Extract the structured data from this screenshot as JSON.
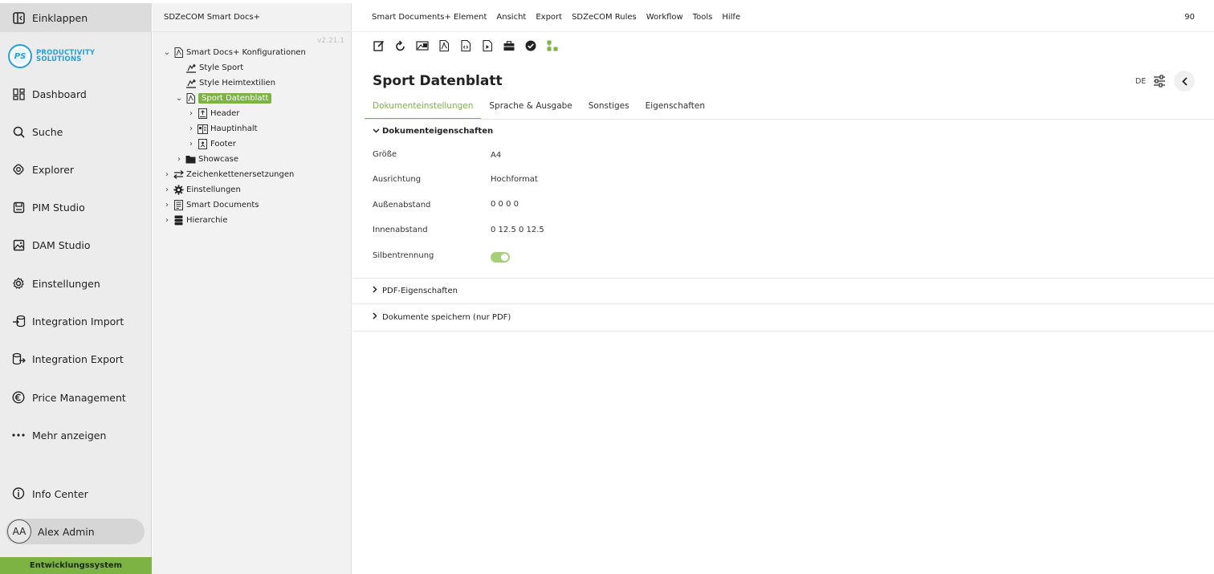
{
  "sidebar": {
    "collapse_label": "Einklappen",
    "logo_initials": "PS",
    "logo_line1": "PRODUCTIVITY",
    "logo_line2": "SOLUTIONS",
    "items": [
      {
        "label": "Dashboard",
        "icon": "dashboard-icon"
      },
      {
        "label": "Suche",
        "icon": "search-icon"
      },
      {
        "label": "Explorer",
        "icon": "explorer-icon"
      },
      {
        "label": "PIM Studio",
        "icon": "pim-icon"
      },
      {
        "label": "DAM Studio",
        "icon": "image-icon"
      },
      {
        "label": "Einstellungen",
        "icon": "gear-icon"
      },
      {
        "label": "Integration Import",
        "icon": "import-icon"
      },
      {
        "label": "Integration Export",
        "icon": "export-icon"
      },
      {
        "label": "Price Management",
        "icon": "euro-icon"
      },
      {
        "label": "Mehr anzeigen",
        "icon": "more-icon"
      }
    ],
    "info_center": "Info Center",
    "user_initials": "AA",
    "user_name": "Alex Admin",
    "environment": "Entwicklungssystem"
  },
  "tree": {
    "header": "SDZeCOM Smart Docs+",
    "version": "v2.21.1",
    "nodes": [
      {
        "label": "Smart Docs+ Konfigurationen"
      },
      {
        "label": "Style Sport"
      },
      {
        "label": "Style Heimtextilien"
      },
      {
        "label": "Sport Datenblatt"
      },
      {
        "label": "Header"
      },
      {
        "label": "Hauptinhalt"
      },
      {
        "label": "Footer"
      },
      {
        "label": "Showcase"
      },
      {
        "label": "Zeichenkettenersetzungen"
      },
      {
        "label": "Einstellungen"
      },
      {
        "label": "Smart Documents"
      },
      {
        "label": "Hierarchie"
      }
    ]
  },
  "menubar": {
    "items": [
      "Smart Documents+ Element",
      "Ansicht",
      "Export",
      "SDZeCOM Rules",
      "Workflow",
      "Tools",
      "Hilfe"
    ],
    "right_value": "90"
  },
  "document": {
    "title": "Sport Datenblatt",
    "language": "DE",
    "tabs": [
      "Dokumenteinstellungen",
      "Sprache & Ausgabe",
      "Sonstiges",
      "Eigenschaften"
    ],
    "section_main": "Dokumenteigenschaften",
    "properties": [
      {
        "label": "Größe",
        "value": "A4"
      },
      {
        "label": "Ausrichtung",
        "value": "Hochformat"
      },
      {
        "label": "Außenabstand",
        "value": "0 0 0 0"
      },
      {
        "label": "Innenabstand",
        "value": "0 12.5 0 12.5"
      }
    ],
    "hyphenation_label": "Silbentrennung",
    "hyphenation_enabled": true,
    "section_pdf": "PDF-Eigenschaften",
    "section_save": "Dokumente speichern (nur PDF)"
  },
  "colors": {
    "accent": "#7cb342",
    "logo_blue": "#2a9fd6"
  }
}
